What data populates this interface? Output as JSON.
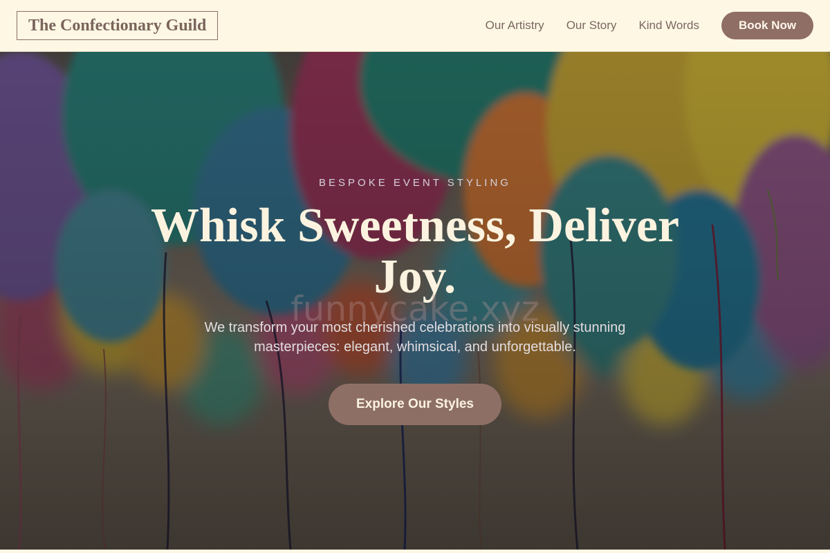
{
  "header": {
    "logo": "The Confectionary Guild",
    "nav": [
      "Our Artistry",
      "Our Story",
      "Kind Words"
    ],
    "book_label": "Book Now"
  },
  "hero": {
    "eyebrow": "BESPOKE EVENT STYLING",
    "headline": "Whisk Sweetness, Deliver Joy.",
    "watermark": "funnycake.xyz",
    "subtext": "We transform your most cherished celebrations into visually stunning masterpieces: elegant, whimsical, and unforgettable.",
    "cta_label": "Explore Our Styles",
    "background": "balloons-photo"
  },
  "colors": {
    "header_bg": "#fef7e4",
    "accent": "#8f6e66",
    "headline": "#fbf3df"
  }
}
